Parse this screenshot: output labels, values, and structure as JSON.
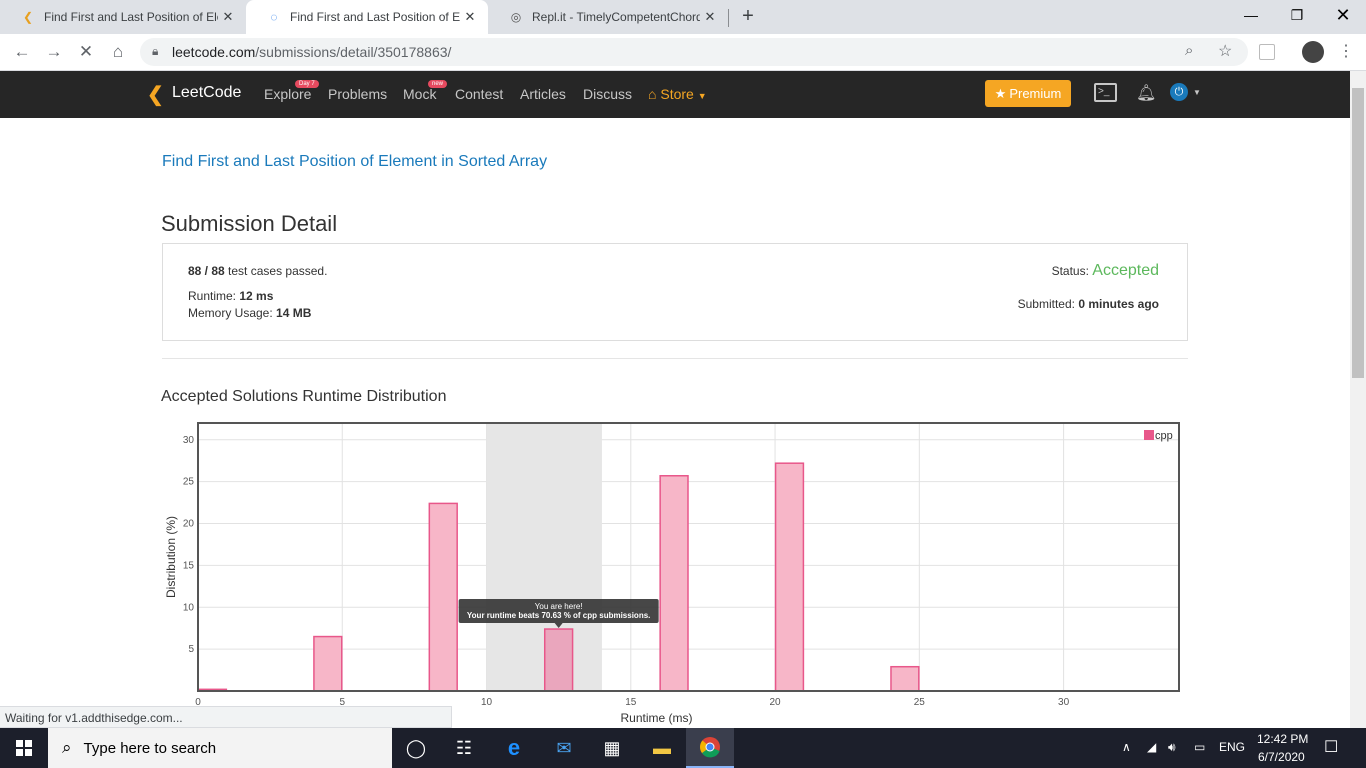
{
  "browser": {
    "tabs": [
      {
        "title": "Find First and Last Position of Ele",
        "active": false
      },
      {
        "title": "Find First and Last Position of Ele",
        "active": true
      },
      {
        "title": "Repl.it - TimelyCompetentChord",
        "active": false
      }
    ],
    "url_host": "leetcode.com",
    "url_path": "/submissions/detail/350178863/",
    "status_bubble": "Waiting for v1.addthisedge.com..."
  },
  "nav": {
    "logo": "LeetCode",
    "items": [
      {
        "label": "Explore",
        "badge": "Day 7"
      },
      {
        "label": "Problems",
        "badge": ""
      },
      {
        "label": "Mock",
        "badge": "new"
      },
      {
        "label": "Contest",
        "badge": ""
      },
      {
        "label": "Articles",
        "badge": ""
      },
      {
        "label": "Discuss",
        "badge": ""
      }
    ],
    "store": "Store",
    "premium": "Premium",
    "accent": "#f5a623"
  },
  "page": {
    "problem_title": "Find First and Last Position of Element in Sorted Array",
    "heading": "Submission Detail",
    "passed_count": "88 / 88",
    "passed_suffix": "test cases passed.",
    "status_label": "Status:",
    "status_value": "Accepted",
    "runtime_label": "Runtime:",
    "runtime_value": "12 ms",
    "memory_label": "Memory Usage:",
    "memory_value": "14 MB",
    "submitted_label": "Submitted:",
    "submitted_value": "0 minutes ago",
    "dist_title": "Accepted Solutions Runtime Distribution"
  },
  "chart_data": {
    "type": "bar",
    "xlabel": "Runtime (ms)",
    "ylabel": "Distribution (%)",
    "xlim": [
      0,
      34
    ],
    "ylim": [
      0,
      32
    ],
    "xticks": [
      0,
      5,
      10,
      15,
      20,
      25,
      30
    ],
    "yticks": [
      5,
      10,
      15,
      20,
      25,
      30
    ],
    "series": [
      {
        "name": "cpp",
        "x": [
          0,
          4,
          8,
          12,
          16,
          20,
          24
        ],
        "values": [
          0.2,
          6.5,
          22.4,
          7.4,
          25.7,
          27.2,
          2.9
        ]
      }
    ],
    "highlight_x": 12,
    "highlight_range": [
      10,
      14
    ],
    "tooltip_line1": "You are here!",
    "tooltip_line2": "Your runtime beats 70.63 % of cpp submissions.",
    "legend_position": "top-right",
    "bar_color": "#f7b6c8",
    "bar_stroke": "#e8578a"
  },
  "taskbar": {
    "search_placeholder": "Type here to search",
    "language": "ENG",
    "time": "12:42 PM",
    "date": "6/7/2020"
  }
}
